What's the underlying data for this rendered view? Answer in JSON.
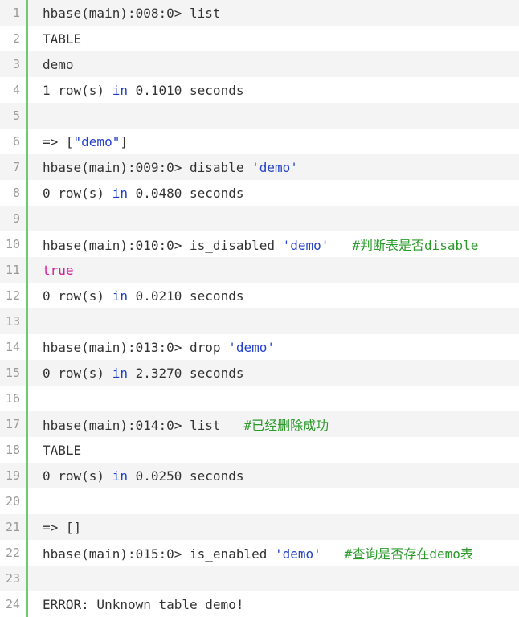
{
  "colors": {
    "gutter_border": "#6ccc6c",
    "keyword": "#1a3cc8",
    "string": "#2643c8",
    "boolean": "#d0209a",
    "comment": "#2a9a2a",
    "text": "#333333",
    "line_number": "#9a9a9a"
  },
  "lines": [
    {
      "n": "1",
      "p1": "hbase(main):008:0> list"
    },
    {
      "n": "2",
      "p1": "TABLE"
    },
    {
      "n": "3",
      "p1": "demo"
    },
    {
      "n": "4",
      "p1": "1 row(s) ",
      "kw": "in",
      "p2": " 0.1010 seconds"
    },
    {
      "n": "5"
    },
    {
      "n": "6",
      "p1": "=> [",
      "str": "\"demo\"",
      "p2": "]"
    },
    {
      "n": "7",
      "p1": "hbase(main):009:0> disable ",
      "str": "'demo'"
    },
    {
      "n": "8",
      "p1": "0 row(s) ",
      "kw": "in",
      "p2": " 0.0480 seconds"
    },
    {
      "n": "9"
    },
    {
      "n": "10",
      "p1": "hbase(main):010:0> is_disabled ",
      "str": "'demo'",
      "p2": "   ",
      "cmt": "#判断表是否disable"
    },
    {
      "n": "11",
      "bool": "true"
    },
    {
      "n": "12",
      "p1": "0 row(s) ",
      "kw": "in",
      "p2": " 0.0210 seconds"
    },
    {
      "n": "13"
    },
    {
      "n": "14",
      "p1": "hbase(main):013:0> drop ",
      "str": "'demo'"
    },
    {
      "n": "15",
      "p1": "0 row(s) ",
      "kw": "in",
      "p2": " 2.3270 seconds"
    },
    {
      "n": "16"
    },
    {
      "n": "17",
      "p1": "hbase(main):014:0> list   ",
      "cmt": "#已经删除成功"
    },
    {
      "n": "18",
      "p1": "TABLE"
    },
    {
      "n": "19",
      "p1": "0 row(s) ",
      "kw": "in",
      "p2": " 0.0250 seconds"
    },
    {
      "n": "20"
    },
    {
      "n": "21",
      "p1": "=> []"
    },
    {
      "n": "22",
      "p1": "hbase(main):015:0> is_enabled ",
      "str": "'demo'",
      "p2": "   ",
      "cmt": "#查询是否存在demo表"
    },
    {
      "n": "23"
    },
    {
      "n": "24",
      "p1": "ERROR: Unknown table demo!"
    }
  ]
}
